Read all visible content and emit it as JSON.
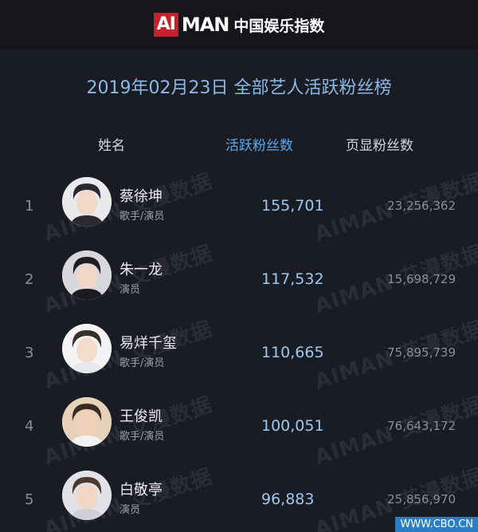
{
  "header": {
    "logo_ai": "AI",
    "logo_man": "MAN",
    "logo_cn": "中国娱乐指数"
  },
  "title": "2019年02月23日 全部艺人活跃粉丝榜",
  "columns": {
    "name": "姓名",
    "active": "活跃粉丝数",
    "page": "页显粉丝数"
  },
  "rows": [
    {
      "rank": "1",
      "name": "蔡徐坤",
      "role": "歌手/演员",
      "active": "155,701",
      "page": "23,256,362"
    },
    {
      "rank": "2",
      "name": "朱一龙",
      "role": "演员",
      "active": "117,532",
      "page": "15,698,729"
    },
    {
      "rank": "3",
      "name": "易烊千玺",
      "role": "歌手/演员",
      "active": "110,665",
      "page": "75,895,739"
    },
    {
      "rank": "4",
      "name": "王俊凯",
      "role": "歌手/演员",
      "active": "100,051",
      "page": "76,643,172"
    },
    {
      "rank": "5",
      "name": "白敬亭",
      "role": "演员",
      "active": "96,883",
      "page": "25,856,970"
    }
  ],
  "watermark": "AIMAN 艾漫数据",
  "footer": "WWW.CBO.CN",
  "colors": {
    "background": "#1a1c24",
    "title": "#8cb8e6",
    "active_header": "#5aa8ec",
    "logo_red": "#c8202a"
  }
}
